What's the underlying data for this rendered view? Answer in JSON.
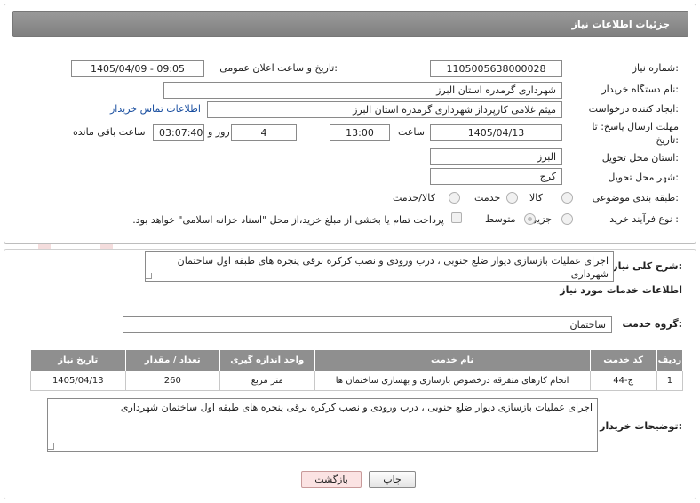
{
  "header": {
    "title": "جزئیات اطلاعات نیاز"
  },
  "fields": {
    "need_number_label": "شماره نیاز:",
    "need_number": "1105005638000028",
    "announce_label": "تاریخ و ساعت اعلان عمومی:",
    "announce_value": "1405/04/09 - 09:05",
    "buyer_org_label": "نام دستگاه خریدار:",
    "buyer_org": "شهرداری گرمدره استان البرز",
    "creator_label": "ایجاد کننده درخواست:",
    "creator": "میثم غلامی کارپرداز شهرداری گرمدره استان البرز",
    "contact_link": "اطلاعات تماس خریدار",
    "deadline_label_1": "مهلت ارسال پاسخ: تا",
    "deadline_label_2": "تاریخ:",
    "deadline_date": "1405/04/13",
    "hour_label": "ساعت",
    "deadline_time": "13:00",
    "days_value": "4",
    "days_label": "روز و",
    "remaining_time": "03:07:40",
    "remaining_label": "ساعت باقی مانده",
    "province_label": "استان محل تحویل:",
    "province": "البرز",
    "city_label": "شهر محل تحویل:",
    "city": "کرج",
    "category_label": "طبقه بندی موضوعی:",
    "category_options": [
      "کالا",
      "خدمت",
      "کالا/خدمت"
    ],
    "purchase_type_label": "نوع فرآیند خرید :",
    "purchase_options": [
      "جزیی",
      "متوسط"
    ],
    "payment_note": "پرداخت تمام یا بخشی از مبلغ خرید،از محل \"اسناد خزانه اسلامی\" خواهد بود."
  },
  "summary": {
    "label": "شرح کلی نیاز:",
    "text": "اجرای عملیات بازسازی دیوار ضلع جنوبی ، درب ورودی و نصب کرکره برقی پنجره های طبقه اول ساختمان شهرداری"
  },
  "services": {
    "section_title": "اطلاعات خدمات مورد نیاز",
    "group_label": "گروه خدمت:",
    "group_value": "ساختمان",
    "columns": [
      "ردیف",
      "کد خدمت",
      "نام خدمت",
      "واحد اندازه گیری",
      "تعداد / مقدار",
      "تاریخ نیاز"
    ],
    "rows": [
      [
        "1",
        "ج-44",
        "انجام کارهای متفرقه درخصوص بازسازی و بهسازی ساختمان ها",
        "متر مربع",
        "260",
        "1405/04/13"
      ]
    ]
  },
  "buyer_notes": {
    "label": "توضیحات خریدار:",
    "text": "اجرای عملیات بازسازی دیوار ضلع جنوبی ، درب ورودی و نصب کرکره برقی پنجره های طبقه اول ساختمان شهرداری"
  },
  "buttons": {
    "print": "چاپ",
    "back": "بازگشت"
  },
  "watermark": "AriaTender.net",
  "colors": {
    "title_bar": "#8a8a8a",
    "link": "#1a4fa0",
    "table_header": "#8f8f8f",
    "back_button": "#fbe3e3"
  }
}
